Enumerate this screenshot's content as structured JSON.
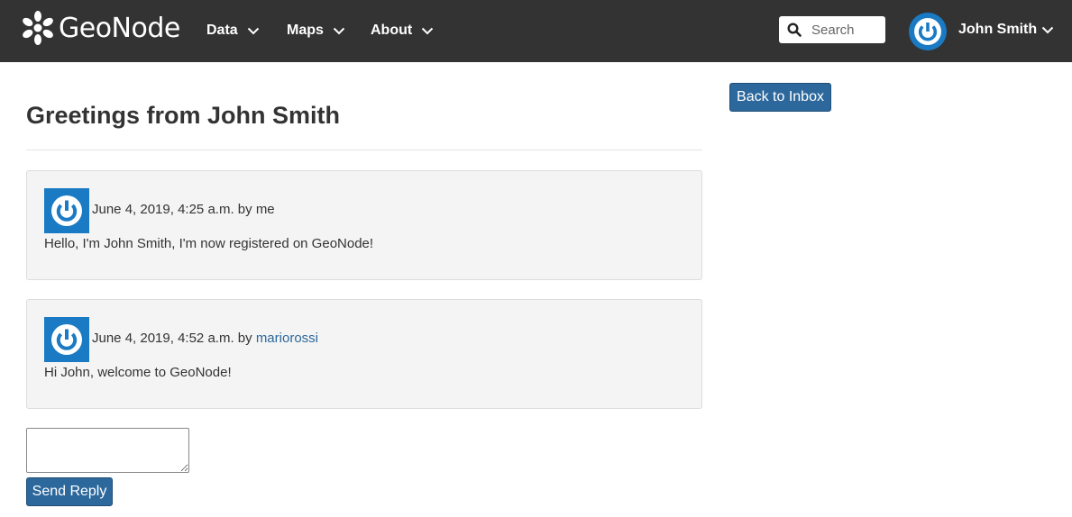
{
  "navbar": {
    "brand": "GeoNode",
    "menus": [
      {
        "label": "Data"
      },
      {
        "label": "Maps"
      },
      {
        "label": "About"
      }
    ],
    "search": {
      "placeholder": "Search",
      "value": ""
    },
    "user": {
      "name": "John Smith"
    }
  },
  "page": {
    "title": "Greetings from John Smith",
    "back_button_label": "Back to Inbox"
  },
  "messages": [
    {
      "timestamp": "June 4, 2019, 4:25 a.m.",
      "by_prefix": "by",
      "author": "me",
      "author_is_link": false,
      "body": "Hello, I'm John Smith, I'm now registered on GeoNode!"
    },
    {
      "timestamp": "June 4, 2019, 4:52 a.m.",
      "by_prefix": "by",
      "author": "mariorossi",
      "author_is_link": true,
      "body": "Hi John, welcome to GeoNode!"
    }
  ],
  "reply": {
    "value": "",
    "send_label": "Send Reply"
  },
  "colors": {
    "navbar_bg": "#333333",
    "primary_button": "#2c689c",
    "link": "#2c689c",
    "avatar_blue": "#1a7ac4",
    "card_bg": "#f4f4f4"
  },
  "icons": {
    "brand": "geonode-logo-icon",
    "menu_chevron": "chevron-down-icon",
    "search": "search-icon",
    "avatar": "power-avatar-icon"
  }
}
